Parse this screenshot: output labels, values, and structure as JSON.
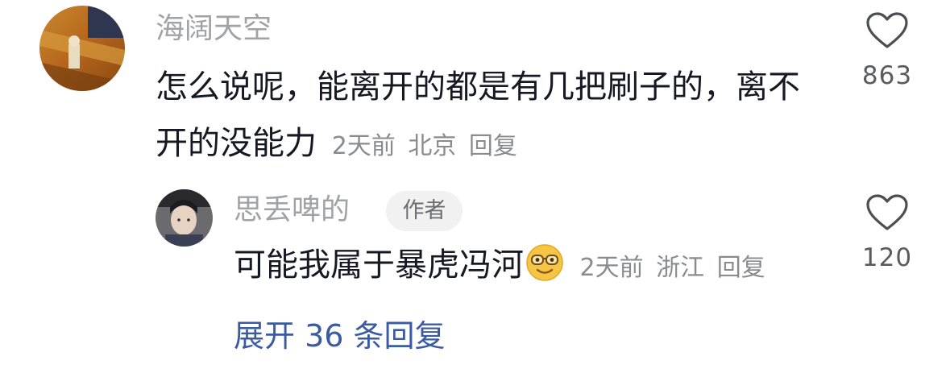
{
  "comment": {
    "username": "海阔天空",
    "text": "怎么说呢，能离开的都是有几把刷子的，离不开的没能力",
    "time": "2天前",
    "location": "北京",
    "reply_label": "回复",
    "likes": "863",
    "avatar": "avatar-image",
    "like_icon": "heart-outline-icon"
  },
  "reply": {
    "username": "思丢啤的",
    "badge": "作者",
    "text": "可能我属于暴虎冯河",
    "emoji": "sunglasses-smile-emoji",
    "time": "2天前",
    "location": "浙江",
    "reply_label": "回复",
    "likes": "120",
    "avatar": "avatar-image",
    "like_icon": "heart-outline-icon"
  },
  "expand_label": "展开 36 条回复",
  "colors": {
    "username": "#a1a2a7",
    "text": "#161823",
    "meta": "#8a8b91",
    "link": "#3a5aa2",
    "badge_bg": "#f1f1f2"
  }
}
